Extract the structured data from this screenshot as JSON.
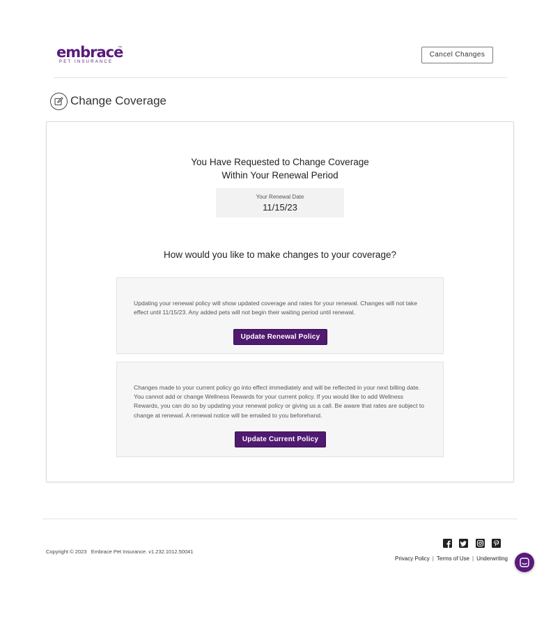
{
  "header": {
    "logo_word": "embrace",
    "logo_tm": "™",
    "logo_sub": "PET INSURANCE",
    "cancel_label": "Cancel Changes"
  },
  "page": {
    "title": "Change Coverage",
    "title_icon": "edit-icon"
  },
  "card": {
    "headline": "You Have Requested to Change Coverage Within Your Renewal Period",
    "renewal_label": "Your Renewal Date",
    "renewal_date": "11/15/23",
    "question": "How would you like to make changes to your coverage?",
    "options": [
      {
        "text": "Updating your renewal policy will show updated coverage and rates for your renewal. Changes will not take effect until 11/15/23. Any added pets will not begin their waiting period until renewal.",
        "button": "Update Renewal Policy"
      },
      {
        "text": "Changes made to your current policy go into effect immediately and will be reflected in your next billing date. You cannot add or change Wellness Rewards for your current policy. If you would like to add Wellness Rewards, you can do so by updating your renewal policy or giving us a call. Be aware that rates are subject to change at renewal. A renewal notice will be emailed to you beforehand.",
        "button": "Update Current Policy"
      }
    ]
  },
  "footer": {
    "copyright": "Copyright © 2023   Embrace Pet Insurance. v1.232.1012.50041",
    "social_icons": [
      "facebook-icon",
      "twitter-icon",
      "instagram-icon",
      "pinterest-icon"
    ],
    "links": [
      "Privacy Policy",
      "Terms of Use",
      "Underwriting"
    ],
    "separator": "|"
  },
  "colors": {
    "brand_purple": "#5a1a7c",
    "button_purple": "#4f1a6f"
  }
}
